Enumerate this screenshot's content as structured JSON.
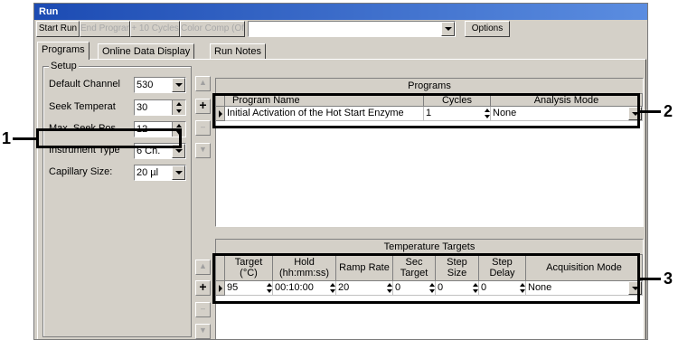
{
  "window": {
    "title": "Run"
  },
  "toolbar": {
    "start_run": "Start Run",
    "end_program": "End Program",
    "plus_10_cycles": "+ 10 Cycles",
    "color_comp": "Color Comp (Off)",
    "run_select_value": "",
    "options": "Options"
  },
  "tabs": [
    "Programs",
    "Online Data Display",
    "Run Notes"
  ],
  "setup": {
    "title": "Setup",
    "fields": [
      {
        "label": "Default Channel",
        "value": "530",
        "control": "dropdown"
      },
      {
        "label": "Seek Temperat",
        "value": "30",
        "control": "spinner"
      },
      {
        "label": "Max. Seek Pos.",
        "value": "12",
        "control": "spinner"
      },
      {
        "label": "Instrument Type",
        "value": "6 Ch.",
        "control": "dropdown"
      },
      {
        "label": "Capillary Size:",
        "value": "20 µl",
        "control": "dropdown"
      }
    ]
  },
  "programs": {
    "caption": "Programs",
    "columns": [
      "Program Name",
      "Cycles",
      "Analysis Mode"
    ],
    "rows": [
      {
        "name": "Initial Activation of the Hot Start Enzyme",
        "cycles": "1",
        "analysis": "None"
      }
    ]
  },
  "temperature": {
    "caption": "Temperature Targets",
    "columns": [
      "Target (°C)",
      "Hold (hh:mm:ss)",
      "Ramp Rate",
      "Sec Target",
      "Step Size",
      "Step Delay",
      "Acquisition Mode"
    ],
    "rows": [
      {
        "target": "95",
        "hold": "00:10:00",
        "ramp": "20",
        "sec_target": "0",
        "step_size": "0",
        "step_delay": "0",
        "acquisition": "None"
      }
    ]
  },
  "side_buttons": {
    "add": "+",
    "remove": "–"
  },
  "callouts": [
    "1",
    "2",
    "3"
  ]
}
